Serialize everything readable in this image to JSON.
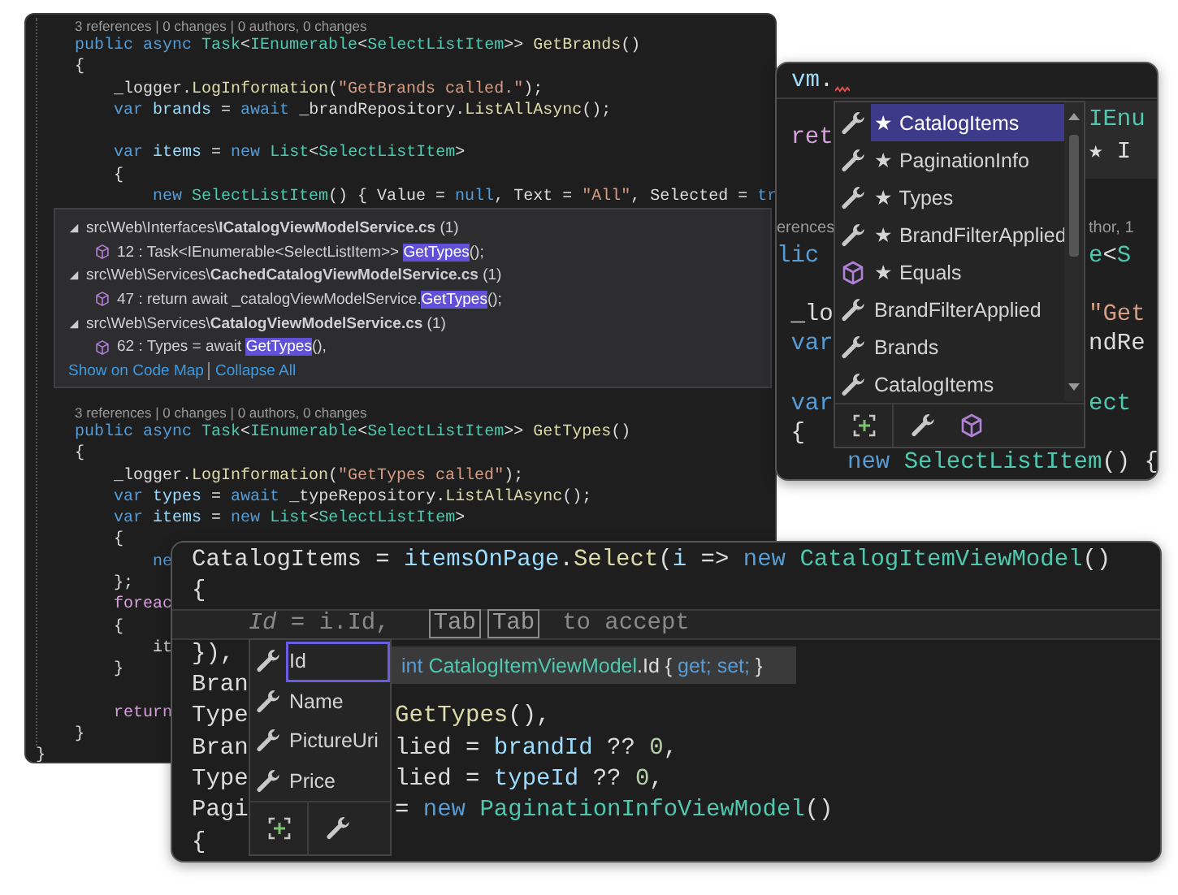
{
  "editor_back": {
    "lines_above": [
      {
        "kind": "lens",
        "text": "3 references | 0 changes | 0 authors, 0 changes"
      },
      {
        "kind": "code",
        "tokens": [
          {
            "text": "public async ",
            "kind": "kw"
          },
          {
            "text": "Task",
            "kind": "type"
          },
          {
            "text": "<",
            "kind": "p"
          },
          {
            "text": "IEnumerable",
            "kind": "type"
          },
          {
            "text": "<",
            "kind": "p"
          },
          {
            "text": "SelectListItem",
            "kind": "type"
          },
          {
            "text": ">> ",
            "kind": "p"
          },
          {
            "text": "GetBrands",
            "kind": "fn"
          },
          {
            "text": "()",
            "kind": "p"
          }
        ]
      },
      {
        "kind": "code",
        "tokens": [
          {
            "text": "{",
            "kind": "p"
          }
        ]
      },
      {
        "kind": "code",
        "tokens": [
          {
            "text": "    _logger.",
            "kind": "p"
          },
          {
            "text": "LogInformation",
            "kind": "fn"
          },
          {
            "text": "(",
            "kind": "p"
          },
          {
            "text": "\"GetBrands called.\"",
            "kind": "str"
          },
          {
            "text": ");",
            "kind": "p"
          }
        ]
      },
      {
        "kind": "code",
        "tokens": [
          {
            "text": "    var ",
            "kind": "kw"
          },
          {
            "text": "brands",
            "kind": "var"
          },
          {
            "text": " = ",
            "kind": "p"
          },
          {
            "text": "await ",
            "kind": "kw"
          },
          {
            "text": "_brandRepository.",
            "kind": "p"
          },
          {
            "text": "ListAllAsync",
            "kind": "fn"
          },
          {
            "text": "();",
            "kind": "p"
          }
        ]
      },
      {
        "kind": "blank"
      },
      {
        "kind": "code",
        "tokens": [
          {
            "text": "    var ",
            "kind": "kw"
          },
          {
            "text": "items",
            "kind": "var"
          },
          {
            "text": " = ",
            "kind": "p"
          },
          {
            "text": "new ",
            "kind": "kw"
          },
          {
            "text": "List",
            "kind": "type"
          },
          {
            "text": "<",
            "kind": "p"
          },
          {
            "text": "SelectListItem",
            "kind": "type"
          },
          {
            "text": ">",
            "kind": "p"
          }
        ]
      },
      {
        "kind": "code",
        "tokens": [
          {
            "text": "    {",
            "kind": "p"
          }
        ]
      },
      {
        "kind": "code",
        "tokens": [
          {
            "text": "        new ",
            "kind": "kw"
          },
          {
            "text": "SelectListItem",
            "kind": "type"
          },
          {
            "text": "() { Value = ",
            "kind": "p"
          },
          {
            "text": "null",
            "kind": "kw"
          },
          {
            "text": ", Text = ",
            "kind": "p"
          },
          {
            "text": "\"All\"",
            "kind": "str"
          },
          {
            "text": ", Selected = ",
            "kind": "p"
          },
          {
            "text": "tr",
            "kind": "kw"
          }
        ]
      }
    ],
    "peek": {
      "groups": [
        {
          "folder": "src\\Web\\Interfaces\\",
          "file": "ICatalogViewModelService.cs",
          "count": "(1)",
          "expanded": true,
          "results": [
            {
              "before": "12 : Task<IEnumerable<SelectListItem>> ",
              "match": "GetTypes",
              "after": "();"
            }
          ]
        },
        {
          "folder": "src\\Web\\Services\\",
          "file": "CachedCatalogViewModelService.cs",
          "count": "(1)",
          "expanded": true,
          "results": [
            {
              "before": "47 : return await _catalogViewModelService.",
              "match": "GetTypes",
              "after": "();"
            }
          ]
        },
        {
          "folder": "src\\Web\\Services\\",
          "file": "CatalogViewModelService.cs",
          "count": "(1)",
          "expanded": true,
          "results": [
            {
              "before": "62 : Types = await ",
              "match": "GetTypes",
              "after": "(),"
            }
          ]
        }
      ],
      "links": [
        "Show on Code Map",
        "Collapse All"
      ]
    },
    "lines_below": [
      {
        "kind": "lens",
        "text": "3 references | 0 changes | 0 authors, 0 changes"
      },
      {
        "kind": "code",
        "tokens": [
          {
            "text": "public async ",
            "kind": "kw"
          },
          {
            "text": "Task",
            "kind": "type"
          },
          {
            "text": "<",
            "kind": "p"
          },
          {
            "text": "IEnumerable",
            "kind": "type"
          },
          {
            "text": "<",
            "kind": "p"
          },
          {
            "text": "SelectListItem",
            "kind": "type"
          },
          {
            "text": ">> ",
            "kind": "p"
          },
          {
            "text": "GetTypes",
            "kind": "fn"
          },
          {
            "text": "()",
            "kind": "p"
          }
        ]
      },
      {
        "kind": "code",
        "tokens": [
          {
            "text": "{",
            "kind": "p"
          }
        ]
      },
      {
        "kind": "code",
        "tokens": [
          {
            "text": "    _logger.",
            "kind": "p"
          },
          {
            "text": "LogInformation",
            "kind": "fn"
          },
          {
            "text": "(",
            "kind": "p"
          },
          {
            "text": "\"GetTypes called\"",
            "kind": "str"
          },
          {
            "text": ");",
            "kind": "p"
          }
        ]
      },
      {
        "kind": "code",
        "tokens": [
          {
            "text": "    var ",
            "kind": "kw"
          },
          {
            "text": "types",
            "kind": "var"
          },
          {
            "text": " = ",
            "kind": "p"
          },
          {
            "text": "await ",
            "kind": "kw"
          },
          {
            "text": "_typeRepository.",
            "kind": "p"
          },
          {
            "text": "ListAllAsync",
            "kind": "fn"
          },
          {
            "text": "();",
            "kind": "p"
          }
        ]
      },
      {
        "kind": "code",
        "tokens": [
          {
            "text": "    var ",
            "kind": "kw"
          },
          {
            "text": "items",
            "kind": "var"
          },
          {
            "text": " = ",
            "kind": "p"
          },
          {
            "text": "new ",
            "kind": "kw"
          },
          {
            "text": "List",
            "kind": "type"
          },
          {
            "text": "<",
            "kind": "p"
          },
          {
            "text": "SelectListItem",
            "kind": "type"
          },
          {
            "text": ">",
            "kind": "p"
          }
        ]
      },
      {
        "kind": "code",
        "tokens": [
          {
            "text": "    {",
            "kind": "p"
          }
        ]
      },
      {
        "kind": "code",
        "tokens": [
          {
            "text": "        ne",
            "kind": "kw"
          }
        ]
      },
      {
        "kind": "code",
        "tokens": [
          {
            "text": "    };",
            "kind": "p"
          }
        ]
      },
      {
        "kind": "code",
        "tokens": [
          {
            "text": "    foreac",
            "kind": "ctl"
          }
        ]
      },
      {
        "kind": "code",
        "tokens": [
          {
            "text": "    {",
            "kind": "p"
          }
        ]
      },
      {
        "kind": "code",
        "tokens": [
          {
            "text": "        it",
            "kind": "p"
          }
        ]
      },
      {
        "kind": "code",
        "tokens": [
          {
            "text": "    }",
            "kind": "p"
          }
        ]
      },
      {
        "kind": "blank"
      },
      {
        "kind": "code",
        "tokens": [
          {
            "text": "    return",
            "kind": "ctl"
          }
        ]
      },
      {
        "kind": "code",
        "tokens": [
          {
            "text": "}",
            "kind": "p"
          }
        ]
      }
    ],
    "closing": [
      {
        "text": "}",
        "kind": "p"
      }
    ]
  },
  "editor_right": {
    "input": [
      {
        "text": "vm",
        "kind": "var"
      },
      {
        "text": ".",
        "kind": "p"
      }
    ],
    "lines": [
      {
        "kind": "split",
        "left": [
          {
            "text": " ret",
            "kind": "ctl"
          }
        ]
      },
      {
        "kind": "blank"
      },
      {
        "kind": "blank"
      },
      {
        "kind": "split",
        "left": [
          {
            "text": "erences",
            "kind": "lens"
          }
        ],
        "right": [
          {
            "text": "thor, 1",
            "kind": "lens"
          }
        ]
      },
      {
        "kind": "split",
        "left": [
          {
            "text": "lic",
            "kind": "kw"
          }
        ],
        "right": [
          {
            "text": "e",
            "kind": "type"
          },
          {
            "text": "<",
            "kind": "p"
          },
          {
            "text": "S",
            "kind": "type"
          }
        ]
      },
      {
        "kind": "blank"
      },
      {
        "kind": "split",
        "left": [
          {
            "text": " _lo",
            "kind": "p"
          }
        ],
        "right": [
          {
            "text": "\"Get",
            "kind": "str"
          }
        ]
      },
      {
        "kind": "split",
        "left": [
          {
            "text": " var",
            "kind": "kw"
          }
        ],
        "right": [
          {
            "text": "ndRe",
            "kind": "p"
          }
        ]
      },
      {
        "kind": "blank"
      },
      {
        "kind": "split",
        "left": [
          {
            "text": " var",
            "kind": "kw"
          }
        ],
        "right": [
          {
            "text": "ect",
            "kind": "type"
          }
        ]
      },
      {
        "kind": "split",
        "left": [
          {
            "text": " {",
            "kind": "p"
          }
        ]
      },
      {
        "kind": "full",
        "tokens": [
          {
            "text": "     new ",
            "kind": "kw"
          },
          {
            "text": "SelectListItem",
            "kind": "type"
          },
          {
            "text": "() {",
            "kind": "p"
          }
        ]
      }
    ],
    "tooltip": [
      {
        "text": "IEnu",
        "kind": "type"
      },
      {
        "text": "★ I",
        "kind": "p"
      }
    ],
    "completion": {
      "items": [
        {
          "kind": "wrench",
          "label": "★ CatalogItems",
          "selected": true
        },
        {
          "kind": "wrench",
          "label": "★ PaginationInfo",
          "selected": false
        },
        {
          "kind": "wrench",
          "label": "★ Types",
          "selected": false
        },
        {
          "kind": "wrench",
          "label": "★ BrandFilterApplied",
          "selected": false
        },
        {
          "kind": "cube",
          "label": "★ Equals",
          "selected": false
        },
        {
          "kind": "wrench",
          "label": "BrandFilterApplied",
          "selected": false
        },
        {
          "kind": "wrench",
          "label": "Brands",
          "selected": false
        },
        {
          "kind": "wrench",
          "label": "CatalogItems",
          "selected": false
        }
      ],
      "filters": [
        {
          "kind": "expand"
        },
        {
          "kind": "wrench"
        },
        {
          "kind": "cube"
        }
      ]
    }
  },
  "editor_front": {
    "lines": [
      {
        "kind": "full",
        "tokens": [
          {
            "text": "CatalogItems = ",
            "kind": "p"
          },
          {
            "text": "itemsOnPage",
            "kind": "var"
          },
          {
            "text": ".",
            "kind": "p"
          },
          {
            "text": "Select",
            "kind": "fn"
          },
          {
            "text": "(",
            "kind": "p"
          },
          {
            "text": "i",
            "kind": "var"
          },
          {
            "text": " => ",
            "kind": "p"
          },
          {
            "text": "new ",
            "kind": "kw"
          },
          {
            "text": "CatalogItemViewModel",
            "kind": "type"
          },
          {
            "text": "()",
            "kind": "p"
          }
        ]
      },
      {
        "kind": "full",
        "tokens": [
          {
            "text": "{",
            "kind": "p"
          }
        ]
      },
      {
        "kind": "ghost",
        "text": "    *Id* = i.Id,",
        "keys": [
          "Tab",
          "Tab"
        ],
        "hint": "to accept"
      },
      {
        "kind": "split",
        "left": [
          {
            "text": "}),",
            "kind": "p"
          }
        ]
      },
      {
        "kind": "split",
        "left": [
          {
            "text": "Bran",
            "kind": "p"
          }
        ]
      },
      {
        "kind": "split",
        "left": [
          {
            "text": "Type",
            "kind": "p"
          }
        ],
        "right": [
          {
            "text": "GetTypes",
            "kind": "fn"
          },
          {
            "text": "(),",
            "kind": "p"
          }
        ]
      },
      {
        "kind": "split",
        "left": [
          {
            "text": "Bran",
            "kind": "p"
          }
        ],
        "right": [
          {
            "text": "lied = ",
            "kind": "p"
          },
          {
            "text": "brandId",
            "kind": "var"
          },
          {
            "text": " ?? ",
            "kind": "p"
          },
          {
            "text": "0",
            "kind": "num"
          },
          {
            "text": ",",
            "kind": "p"
          }
        ]
      },
      {
        "kind": "split",
        "left": [
          {
            "text": "Type",
            "kind": "p"
          }
        ],
        "right": [
          {
            "text": "lied = ",
            "kind": "p"
          },
          {
            "text": "typeId",
            "kind": "var"
          },
          {
            "text": " ?? ",
            "kind": "p"
          },
          {
            "text": "0",
            "kind": "num"
          },
          {
            "text": ",",
            "kind": "p"
          }
        ]
      },
      {
        "kind": "split",
        "left": [
          {
            "text": "Pagi",
            "kind": "p"
          }
        ],
        "right": [
          {
            "text": "= ",
            "kind": "p"
          },
          {
            "text": "new ",
            "kind": "kw"
          },
          {
            "text": "PaginationInfoViewModel",
            "kind": "type"
          },
          {
            "text": "()",
            "kind": "p"
          }
        ]
      },
      {
        "kind": "full",
        "tokens": [
          {
            "text": "{",
            "kind": "p"
          }
        ]
      }
    ],
    "completion": {
      "items": [
        {
          "kind": "wrench",
          "label": "Id",
          "selected": true
        },
        {
          "kind": "wrench",
          "label": "Name",
          "selected": false
        },
        {
          "kind": "wrench",
          "label": "PictureUri",
          "selected": false
        },
        {
          "kind": "wrench",
          "label": "Price",
          "selected": false
        }
      ],
      "filters": [
        {
          "kind": "expand"
        },
        {
          "kind": "wrench"
        }
      ]
    },
    "signature": [
      {
        "text": "int ",
        "kind": "kw"
      },
      {
        "text": "CatalogItemViewModel",
        "kind": "type"
      },
      {
        "text": ".Id ",
        "kind": "p"
      },
      {
        "text": "{ ",
        "kind": "p"
      },
      {
        "text": "get; set;",
        "kind": "kw"
      },
      {
        "text": " }",
        "kind": "p"
      }
    ]
  }
}
